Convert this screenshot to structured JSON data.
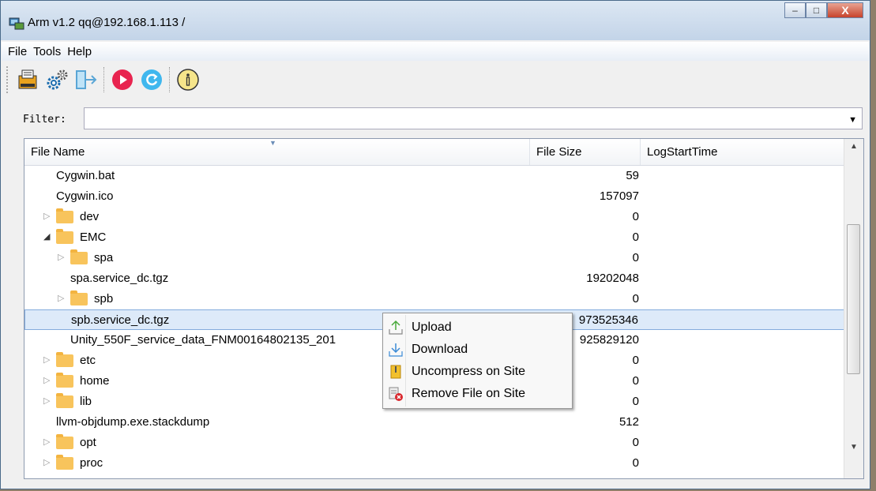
{
  "window": {
    "title": "Arm v1.2 qq@192.168.1.113 /",
    "minimize": "–",
    "maximize": "□",
    "close": "X"
  },
  "menu": [
    "File",
    "Tools",
    "Help"
  ],
  "toolbar": [
    "connect-session-icon",
    "settings-gears-icon",
    "logout-icon",
    "play-icon",
    "refresh-icon",
    "info-icon"
  ],
  "filter": {
    "label": "Filter:",
    "value": ""
  },
  "columns": {
    "name": "File Name",
    "size": "File Size",
    "log": "LogStartTime"
  },
  "rows": [
    {
      "name": "Cygwin.bat",
      "size": "59",
      "type": "file",
      "indent": 0
    },
    {
      "name": "Cygwin.ico",
      "size": "157097",
      "type": "file",
      "indent": 0
    },
    {
      "name": "dev",
      "size": "0",
      "type": "folder",
      "expanded": false,
      "indent": 0
    },
    {
      "name": "EMC",
      "size": "0",
      "type": "folder",
      "expanded": true,
      "indent": 0
    },
    {
      "name": "spa",
      "size": "0",
      "type": "folder",
      "expanded": false,
      "indent": 1
    },
    {
      "name": "spa.service_dc.tgz",
      "size": "19202048",
      "type": "file",
      "indent": 1
    },
    {
      "name": "spb",
      "size": "0",
      "type": "folder",
      "expanded": false,
      "indent": 1
    },
    {
      "name": "spb.service_dc.tgz",
      "size": "973525346",
      "type": "file",
      "indent": 1,
      "selected": true
    },
    {
      "name": "Unity_550F_service_data_FNM00164802135_201",
      "size": "925829120",
      "type": "file",
      "indent": 1
    },
    {
      "name": "etc",
      "size": "0",
      "type": "folder",
      "expanded": false,
      "indent": 0
    },
    {
      "name": "home",
      "size": "0",
      "type": "folder",
      "expanded": false,
      "indent": 0
    },
    {
      "name": "lib",
      "size": "0",
      "type": "folder",
      "expanded": false,
      "indent": 0
    },
    {
      "name": "llvm-objdump.exe.stackdump",
      "size": "512",
      "type": "file",
      "indent": 0
    },
    {
      "name": "opt",
      "size": "0",
      "type": "folder",
      "expanded": false,
      "indent": 0
    },
    {
      "name": "proc",
      "size": "0",
      "type": "folder",
      "expanded": false,
      "indent": 0
    }
  ],
  "context_menu": [
    {
      "label": "Upload",
      "icon": "upload-icon"
    },
    {
      "label": "Download",
      "icon": "download-icon"
    },
    {
      "label": "Uncompress on Site",
      "icon": "zip-icon"
    },
    {
      "label": "Remove File on Site",
      "icon": "remove-file-icon"
    }
  ]
}
